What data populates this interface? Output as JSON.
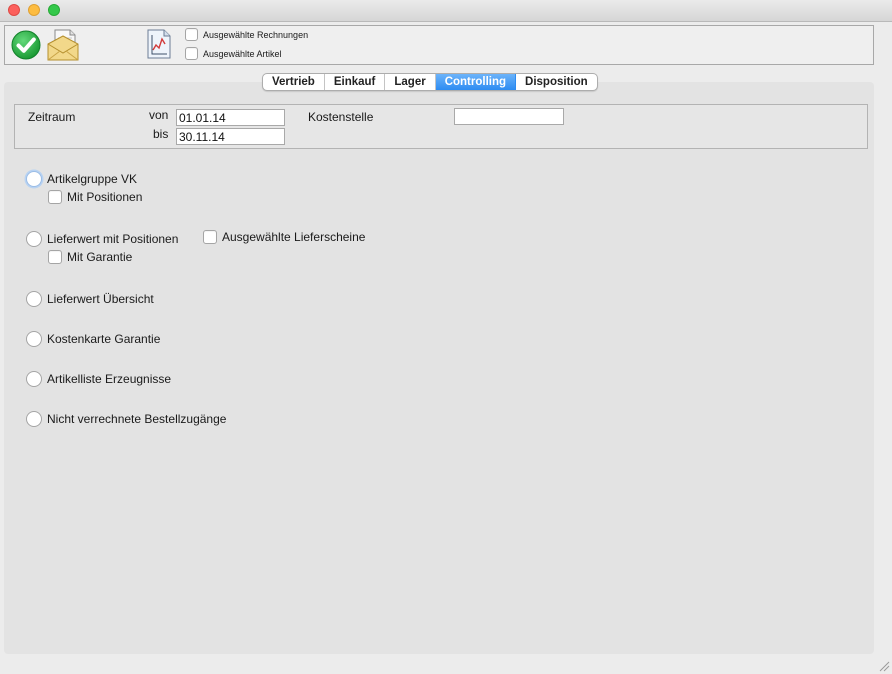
{
  "window": {
    "buttons": [
      "close",
      "minimize",
      "maximize"
    ]
  },
  "toolbar": {
    "icons": [
      "checkmark-icon",
      "mail-document-icon",
      "chart-document-icon"
    ],
    "checkboxes": [
      {
        "label": "Ausgewählte Rechnungen",
        "checked": false
      },
      {
        "label": "Ausgewählte Artikel",
        "checked": false
      }
    ]
  },
  "tabs": [
    {
      "label": "Vertrieb",
      "active": false
    },
    {
      "label": "Einkauf",
      "active": false
    },
    {
      "label": "Lager",
      "active": false
    },
    {
      "label": "Controlling",
      "active": true
    },
    {
      "label": "Disposition",
      "active": false
    }
  ],
  "filters": {
    "zeitraum_label": "Zeitraum",
    "von_label": "von",
    "von_value": "01.01.14",
    "bis_label": "bis",
    "bis_value": "30.11.14",
    "kostenstelle_label": "Kostenstelle",
    "kostenstelle_value": ""
  },
  "options": {
    "artikelgruppe_vk": "Artikelgruppe VK",
    "mit_positionen": "Mit Positionen",
    "lieferwert_mit_positionen": "Lieferwert mit Positionen",
    "ausgewaehlte_lieferscheine": "Ausgewählte Lieferscheine",
    "mit_garantie": "Mit Garantie",
    "lieferwert_uebersicht": "Lieferwert Übersicht",
    "kostenkarte_garantie": "Kostenkarte Garantie",
    "artikelliste_erzeugnisse": "Artikelliste Erzeugnisse",
    "nicht_verrechnete": "Nicht verrechnete Bestellzugänge"
  },
  "colors": {
    "accent": "#2d8cf2",
    "ok_green": "#2bb24c"
  }
}
